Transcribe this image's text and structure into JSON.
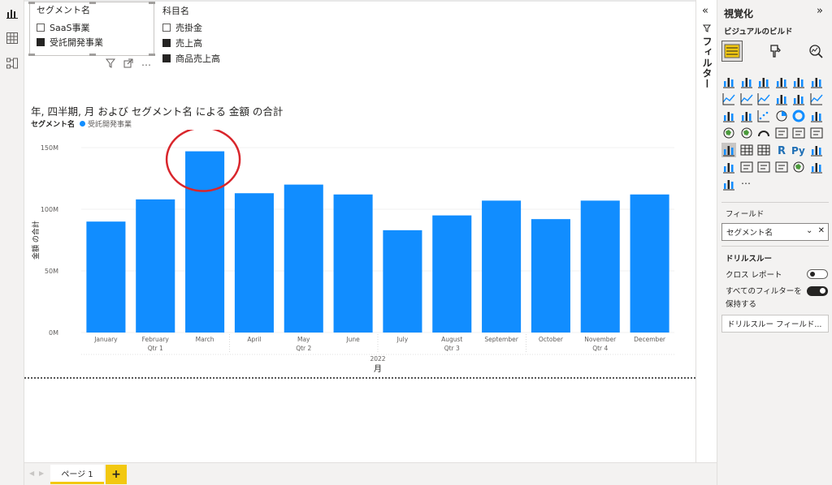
{
  "slicer": {
    "title": "セグメント名",
    "items": [
      {
        "label": "SaaS事業",
        "checked": false
      },
      {
        "label": "受託開発事業",
        "checked": true
      }
    ]
  },
  "legend_slicer": {
    "title": "科目名",
    "items": [
      {
        "label": "売掛金",
        "checked": false
      },
      {
        "label": "売上高",
        "checked": true
      },
      {
        "label": "商品売上高",
        "checked": true
      }
    ]
  },
  "chart_data": {
    "type": "bar",
    "title": "年, 四半期, 月 および セグメント名 による 金額 の合計",
    "legend_title": "セグメント名",
    "ylabel": "金額 の合計",
    "xlabel": "月",
    "ylim": [
      0,
      150
    ],
    "y_ticks": [
      "0M",
      "50M",
      "100M",
      "150M"
    ],
    "categories": [
      "January",
      "February",
      "March",
      "April",
      "May",
      "June",
      "July",
      "August",
      "September",
      "October",
      "November",
      "December"
    ],
    "quarters": [
      "Qtr 1",
      "Qtr 2",
      "Qtr 3",
      "Qtr 4"
    ],
    "year": "2022",
    "color": "#118dff",
    "series": [
      {
        "name": "受託開発事業",
        "values": [
          90,
          108,
          147,
          113,
          120,
          112,
          83,
          95,
          107,
          92,
          107,
          112
        ]
      }
    ],
    "highlight_category": "March",
    "highlight_color": "#d9262c"
  },
  "pages": {
    "active": "ページ 1",
    "add_label": "+"
  },
  "filter_pane": {
    "label": "フィルター",
    "collapse_icon": "«"
  },
  "viz_pane": {
    "title": "視覚化",
    "expand_icon": "»",
    "build_label": "ビジュアルのビルド",
    "fields_label": "フィールド",
    "field_value": "セグメント名",
    "drill_title": "ドリルスルー",
    "cross_report_label": "クロス レポート",
    "keep_filters_label": "すべてのフィルターを保持する",
    "drill_field_placeholder": "ドリルスルー フィールド...",
    "more": "..."
  }
}
